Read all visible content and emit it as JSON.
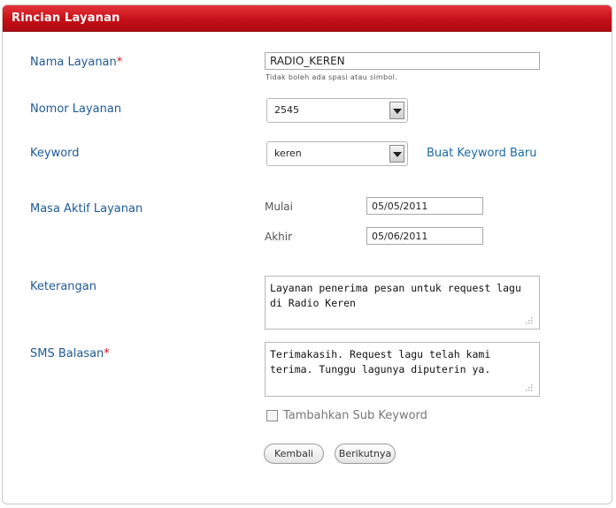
{
  "panel": {
    "title": "Rincian Layanan"
  },
  "fields": {
    "nama_layanan": {
      "label": "Nama Layanan",
      "required_mark": "*",
      "value": "RADIO_KEREN",
      "hint": "Tidak boleh ada spasi atau simbol."
    },
    "nomor_layanan": {
      "label": "Nomor Layanan",
      "selected": "2545"
    },
    "keyword": {
      "label": "Keyword",
      "selected": "keren",
      "new_link": "Buat Keyword Baru"
    },
    "masa_aktif": {
      "label": "Masa Aktif Layanan",
      "mulai_label": "Mulai",
      "mulai_value": "05/05/2011",
      "akhir_label": "Akhir",
      "akhir_value": "05/06/2011"
    },
    "keterangan": {
      "label": "Keterangan",
      "value": "Layanan penerima pesan untuk request lagu di Radio Keren"
    },
    "sms_balasan": {
      "label": "SMS Balasan",
      "required_mark": "*",
      "value": "Terimakasih. Request lagu telah kami terima. Tunggu lagunya diputerin ya."
    },
    "sub_keyword": {
      "label": "Tambahkan Sub Keyword",
      "checked": false
    }
  },
  "buttons": {
    "back": "Kembali",
    "next": "Berikutnya"
  },
  "colors": {
    "header_red": "#c60f17",
    "label_blue": "#1e5a96",
    "required_red": "#d0141c"
  }
}
